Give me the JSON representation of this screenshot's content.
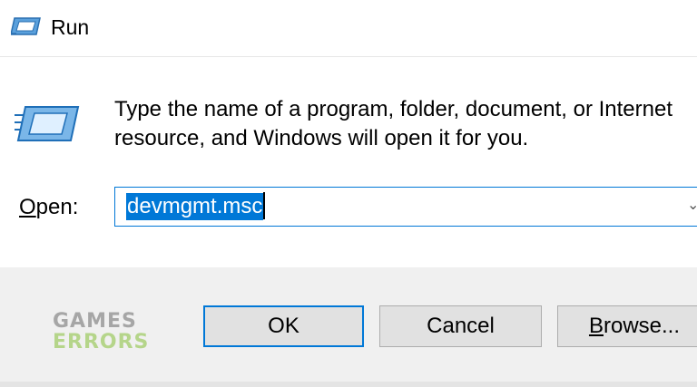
{
  "window": {
    "title": "Run",
    "title_icon": "run-icon"
  },
  "content": {
    "icon": "run-icon",
    "description_line1": "Type the name of a program, folder, document, or Internet",
    "description_line2": "resource, and Windows will open it for you.",
    "open_label_mnemonic": "O",
    "open_label_rest": "pen:",
    "input_value": "devmgmt.msc",
    "dropdown_icon": "chevron-down-icon"
  },
  "buttons": {
    "ok": "OK",
    "cancel": "Cancel",
    "browse_mnemonic": "B",
    "browse_rest": "rowse..."
  },
  "watermark": {
    "line1": "GAMES",
    "line2": "ERRORS"
  },
  "colors": {
    "accent": "#0078d7",
    "footer_bg": "#f0f0f0",
    "button_bg": "#e1e1e1",
    "watermark_gray": "#a6a6a6",
    "watermark_green": "#b5d58a"
  }
}
